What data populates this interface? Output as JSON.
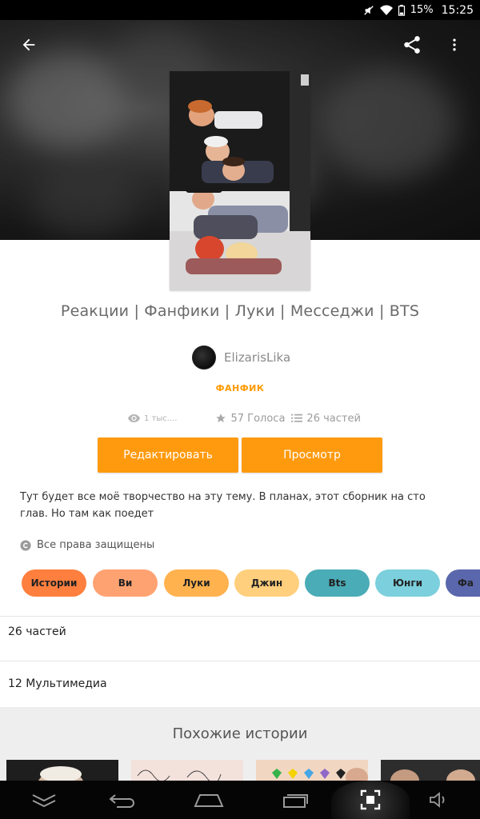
{
  "status_bar": {
    "battery": "15%",
    "time": "15:25"
  },
  "header": {
    "back_icon": "arrow-left-icon",
    "share_icon": "share-icon",
    "menu_icon": "more-vert-icon"
  },
  "story": {
    "title": "Реакции | Фанфики |  Луки |  Месседжи | BTS",
    "author": "ElizarisLika",
    "genre": "ФАНФИК",
    "reads": "1 тыс....",
    "votes": "57 Голоса",
    "parts": "26 частей",
    "description": "Тут будет все моё творчество на эту тему. В планах, этот сборник на сто глав. Но там как поедет",
    "rights": "Все права защищены"
  },
  "actions": {
    "edit_label": "Редактировать",
    "view_label": "Просмотр"
  },
  "tags": [
    {
      "label": "Истории",
      "color": "#ff7f3f"
    },
    {
      "label": "Ви",
      "color": "#ffa272"
    },
    {
      "label": "Луки",
      "color": "#ffb24d"
    },
    {
      "label": "Джин",
      "color": "#ffcf7d"
    },
    {
      "label": "Bts",
      "color": "#4aacb7"
    },
    {
      "label": "Юнги",
      "color": "#7ccfdc"
    },
    {
      "label": "Фа",
      "color": "#5a67ad"
    }
  ],
  "sections": {
    "parts_label": "26 частей",
    "media_label": "12 Мультимедиа",
    "similar_title": "Похожие истории"
  },
  "colors": {
    "accent": "#ff9a0e",
    "genre": "#ff9a00"
  }
}
